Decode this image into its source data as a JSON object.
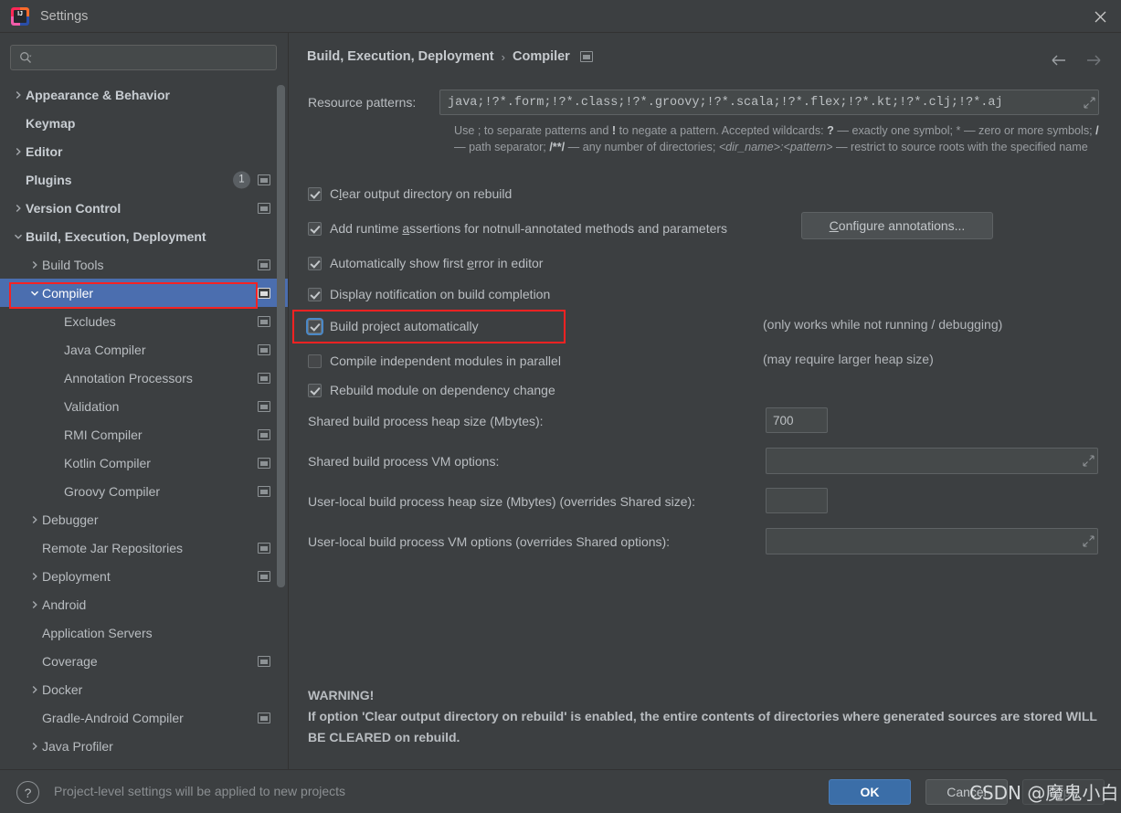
{
  "window": {
    "title": "Settings",
    "app_icon": "intellij-idea-icon",
    "close_icon": "close-icon"
  },
  "search": {
    "placeholder": "",
    "value": "",
    "icon": "search-icon"
  },
  "sidebar": {
    "items": [
      {
        "label": "Appearance & Behavior",
        "arrow": "right",
        "indent": 0,
        "bold": true,
        "panel_icon": false,
        "badge": null,
        "selected": false
      },
      {
        "label": "Keymap",
        "arrow": "none",
        "indent": 0,
        "bold": true,
        "panel_icon": false,
        "badge": null,
        "selected": false
      },
      {
        "label": "Editor",
        "arrow": "right",
        "indent": 0,
        "bold": true,
        "panel_icon": false,
        "badge": null,
        "selected": false
      },
      {
        "label": "Plugins",
        "arrow": "none",
        "indent": 0,
        "bold": true,
        "panel_icon": true,
        "badge": "1",
        "selected": false
      },
      {
        "label": "Version Control",
        "arrow": "right",
        "indent": 0,
        "bold": true,
        "panel_icon": true,
        "badge": null,
        "selected": false
      },
      {
        "label": "Build, Execution, Deployment",
        "arrow": "down",
        "indent": 0,
        "bold": true,
        "panel_icon": false,
        "badge": null,
        "selected": false
      },
      {
        "label": "Build Tools",
        "arrow": "right",
        "indent": 1,
        "bold": false,
        "panel_icon": true,
        "badge": null,
        "selected": false
      },
      {
        "label": "Compiler",
        "arrow": "down",
        "indent": 1,
        "bold": false,
        "panel_icon": true,
        "badge": null,
        "selected": true
      },
      {
        "label": "Excludes",
        "arrow": "none",
        "indent": 2,
        "bold": false,
        "panel_icon": true,
        "badge": null,
        "selected": false
      },
      {
        "label": "Java Compiler",
        "arrow": "none",
        "indent": 2,
        "bold": false,
        "panel_icon": true,
        "badge": null,
        "selected": false
      },
      {
        "label": "Annotation Processors",
        "arrow": "none",
        "indent": 2,
        "bold": false,
        "panel_icon": true,
        "badge": null,
        "selected": false
      },
      {
        "label": "Validation",
        "arrow": "none",
        "indent": 2,
        "bold": false,
        "panel_icon": true,
        "badge": null,
        "selected": false
      },
      {
        "label": "RMI Compiler",
        "arrow": "none",
        "indent": 2,
        "bold": false,
        "panel_icon": true,
        "badge": null,
        "selected": false
      },
      {
        "label": "Kotlin Compiler",
        "arrow": "none",
        "indent": 2,
        "bold": false,
        "panel_icon": true,
        "badge": null,
        "selected": false
      },
      {
        "label": "Groovy Compiler",
        "arrow": "none",
        "indent": 2,
        "bold": false,
        "panel_icon": true,
        "badge": null,
        "selected": false
      },
      {
        "label": "Debugger",
        "arrow": "right",
        "indent": 1,
        "bold": false,
        "panel_icon": false,
        "badge": null,
        "selected": false
      },
      {
        "label": "Remote Jar Repositories",
        "arrow": "none",
        "indent": 1,
        "bold": false,
        "panel_icon": true,
        "badge": null,
        "selected": false
      },
      {
        "label": "Deployment",
        "arrow": "right",
        "indent": 1,
        "bold": false,
        "panel_icon": true,
        "badge": null,
        "selected": false
      },
      {
        "label": "Android",
        "arrow": "right",
        "indent": 1,
        "bold": false,
        "panel_icon": false,
        "badge": null,
        "selected": false
      },
      {
        "label": "Application Servers",
        "arrow": "none",
        "indent": 1,
        "bold": false,
        "panel_icon": false,
        "badge": null,
        "selected": false
      },
      {
        "label": "Coverage",
        "arrow": "none",
        "indent": 1,
        "bold": false,
        "panel_icon": true,
        "badge": null,
        "selected": false
      },
      {
        "label": "Docker",
        "arrow": "right",
        "indent": 1,
        "bold": false,
        "panel_icon": false,
        "badge": null,
        "selected": false
      },
      {
        "label": "Gradle-Android Compiler",
        "arrow": "none",
        "indent": 1,
        "bold": false,
        "panel_icon": true,
        "badge": null,
        "selected": false
      },
      {
        "label": "Java Profiler",
        "arrow": "right",
        "indent": 1,
        "bold": false,
        "panel_icon": false,
        "badge": null,
        "selected": false
      }
    ]
  },
  "header": {
    "breadcrumb_root": "Build, Execution, Deployment",
    "breadcrumb_separator": "›",
    "breadcrumb_current": "Compiler",
    "back_icon": "arrow-left-icon",
    "forward_icon": "arrow-right-icon"
  },
  "main": {
    "resource_patterns": {
      "label": "Resource patterns:",
      "value": "java;!?*.form;!?*.class;!?*.groovy;!?*.scala;!?*.flex;!?*.kt;!?*.clj;!?*.aj",
      "expand_icon": "expand-editor-icon"
    },
    "hint_line1_a": "Use ; to separate patterns and ",
    "hint_bang": "!",
    "hint_line1_b": " to negate a pattern. Accepted wildcards: ",
    "hint_q": "?",
    "hint_line1_c": " — exactly one symbol; * — zero or more symbols; ",
    "hint_slash": "/",
    "hint_line1_d": " — path separator; ",
    "hint_globstar": "/**/",
    "hint_line1_e": " — any number of directories; ",
    "hint_dirpattern": "<dir_name>:<pattern>",
    "hint_line1_f": " — restrict to source roots with the specified name",
    "checkboxes": [
      {
        "label_pre": "C",
        "label_mnemonic": "l",
        "label_post": "ear output directory on rebuild",
        "checked": true,
        "focused": false,
        "note": ""
      },
      {
        "label_pre": "Add runtime ",
        "label_mnemonic": "a",
        "label_post": "ssertions for notnull-annotated methods and parameters",
        "checked": true,
        "focused": false,
        "note": ""
      },
      {
        "label_pre": "Automatically show first ",
        "label_mnemonic": "e",
        "label_post": "rror in editor",
        "checked": true,
        "focused": false,
        "note": ""
      },
      {
        "label_pre": "Display notification on build completion",
        "label_mnemonic": "",
        "label_post": "",
        "checked": true,
        "focused": false,
        "note": ""
      },
      {
        "label_pre": "Build project automatically",
        "label_mnemonic": "",
        "label_post": "",
        "checked": true,
        "focused": true,
        "note": "(only works while not running / debugging)"
      },
      {
        "label_pre": "Compile independent modules in parallel",
        "label_mnemonic": "",
        "label_post": "",
        "checked": false,
        "focused": false,
        "note": "(may require larger heap size)"
      },
      {
        "label_pre": "Rebuild module on dependency change",
        "label_mnemonic": "",
        "label_post": "",
        "checked": true,
        "focused": false,
        "note": ""
      }
    ],
    "configure_annotations": {
      "mnemonic": "C",
      "rest": "onfigure annotations..."
    },
    "fields": [
      {
        "label": "Shared build process heap size (Mbytes):",
        "value": "700",
        "kind": "small"
      },
      {
        "label": "Shared build process VM options:",
        "value": "",
        "kind": "wide"
      },
      {
        "label": "User-local build process heap size (Mbytes) (overrides Shared size):",
        "value": "",
        "kind": "small"
      },
      {
        "label": "User-local build process VM options (overrides Shared options):",
        "value": "",
        "kind": "wide"
      }
    ],
    "warning": {
      "title": "WARNING!",
      "body": "If option 'Clear output directory on rebuild' is enabled, the entire contents of directories where generated sources are stored WILL BE CLEARED on rebuild."
    }
  },
  "footer": {
    "help_icon": "question-mark-icon",
    "note": "Project-level settings will be applied to new projects",
    "ok_label": "OK",
    "cancel_label": "Cancel",
    "apply_label": "Apply"
  },
  "overlay": {
    "watermark": "CSDN @魔鬼小白",
    "annotation_color": "#f52222"
  },
  "colors": {
    "background": "#3c3f41",
    "selection": "#4b6eaf",
    "primary_button": "#3b6ea8",
    "text": "#b9bdc1",
    "annotation": "#f52222"
  }
}
